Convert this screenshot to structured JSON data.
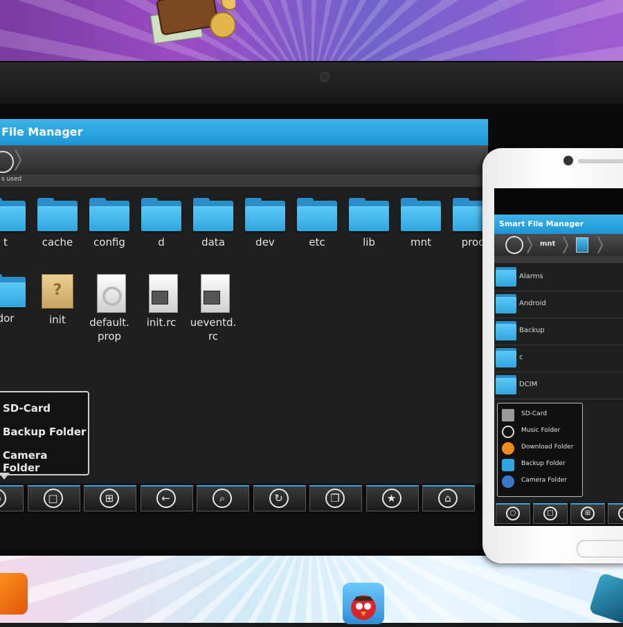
{
  "tablet": {
    "app_title": "Smart File Manager",
    "storage_info": "s used",
    "grid_items": [
      {
        "label": "t",
        "kind": "folder"
      },
      {
        "label": "cache",
        "kind": "folder"
      },
      {
        "label": "config",
        "kind": "folder"
      },
      {
        "label": "d",
        "kind": "folder"
      },
      {
        "label": "data",
        "kind": "folder"
      },
      {
        "label": "dev",
        "kind": "folder"
      },
      {
        "label": "etc",
        "kind": "folder"
      },
      {
        "label": "lib",
        "kind": "folder"
      },
      {
        "label": "mnt",
        "kind": "folder"
      },
      {
        "label": "proc",
        "kind": "folder"
      },
      {
        "label": "dor",
        "kind": "folder"
      },
      {
        "label": "init",
        "kind": "unknown-file"
      },
      {
        "label": "default.\nprop",
        "kind": "settings-file"
      },
      {
        "label": "init.rc",
        "kind": "script-file"
      },
      {
        "label": "ueventd.\nrc",
        "kind": "script-file"
      }
    ],
    "popup_menu": [
      "SD-Card",
      "Backup Folder",
      "Camera Folder"
    ],
    "toolbar_icons": [
      "bookmark-icon",
      "folder-icon",
      "grid-view-icon",
      "back-arrow-icon",
      "search-icon",
      "refresh-icon",
      "copy-icon",
      "star-icon",
      "home-icon"
    ]
  },
  "phone": {
    "app_title": "Smart File Manager",
    "path_segment": "mnt",
    "storage_info": "",
    "folders": [
      "Alarms",
      "Android",
      "Backup",
      "c",
      "DCIM"
    ],
    "popup_menu": [
      "SD-Card",
      "Music Folder",
      "Download Folder",
      "Backup Folder",
      "Camera Folder"
    ],
    "toolbar_icons": [
      "bookmark-icon",
      "folder-icon",
      "grid-view-icon",
      "back-arrow-icon"
    ]
  },
  "colors": {
    "accent_blue": "#33a9e3",
    "folder_blue": "#2fa6e0",
    "screen_bg": "#1f1f1f"
  }
}
